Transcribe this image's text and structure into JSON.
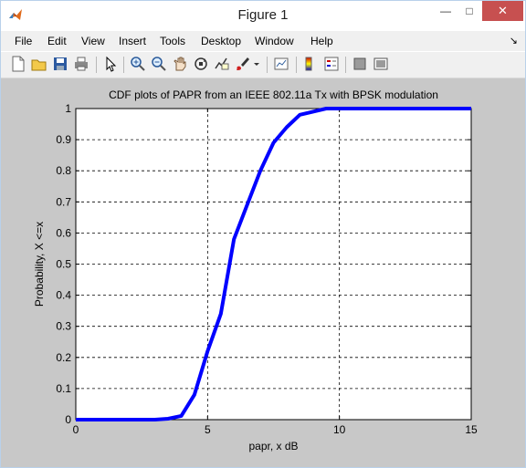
{
  "window": {
    "title": "Figure 1",
    "minimize_glyph": "—",
    "maximize_glyph": "□",
    "close_glyph": "✕"
  },
  "menubar": {
    "items": [
      "File",
      "Edit",
      "View",
      "Insert",
      "Tools",
      "Desktop",
      "Window",
      "Help"
    ],
    "dock_glyph": "↘"
  },
  "toolbar": {
    "buttons": [
      "new-figure-icon",
      "open-file-icon",
      "save-icon",
      "print-icon",
      "pointer-icon",
      "zoom-in-icon",
      "zoom-out-icon",
      "pan-hand-icon",
      "rotate-3d-icon",
      "data-cursor-icon",
      "brush-icon",
      "link-plot-icon",
      "colorbar-icon",
      "legend-icon",
      "hide-plot-tools-icon",
      "show-plot-tools-icon"
    ]
  },
  "colors": {
    "line": "#0000ff",
    "figure_bg": "#c8c8c8",
    "close_button": "#c75050"
  },
  "chart_data": {
    "type": "line",
    "title": "CDF plots of PAPR from an IEEE 802.11a Tx with BPSK modulation",
    "xlabel": "papr, x dB",
    "ylabel": "Probability, X <=x",
    "xlim": [
      0,
      15
    ],
    "ylim": [
      0,
      1
    ],
    "xticks": [
      0,
      5,
      10,
      15
    ],
    "yticks": [
      0,
      0.1,
      0.2,
      0.3,
      0.4,
      0.5,
      0.6,
      0.7,
      0.8,
      0.9,
      1
    ],
    "grid": true,
    "grid_style": "dashed",
    "series": [
      {
        "x": [
          0,
          3.0,
          3.5,
          4.0,
          4.5,
          5.0,
          5.5,
          6.0,
          6.5,
          7.0,
          7.5,
          8.0,
          8.5,
          9.0,
          9.5,
          10.0,
          15
        ],
        "y": [
          0,
          0,
          0.003,
          0.012,
          0.08,
          0.22,
          0.34,
          0.58,
          0.69,
          0.8,
          0.89,
          0.94,
          0.98,
          0.99,
          1.0,
          1.0,
          1.0
        ]
      }
    ]
  }
}
